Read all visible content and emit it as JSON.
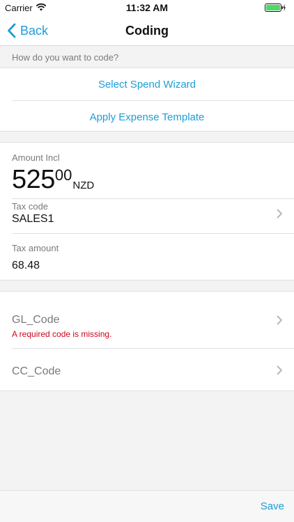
{
  "status_bar": {
    "carrier": "Carrier",
    "time": "11:32 AM",
    "icons": [
      "wifi-icon",
      "battery-icon",
      "charging-bolt-icon"
    ]
  },
  "nav": {
    "back_label": "Back",
    "title": "Coding"
  },
  "coding_section": {
    "header": "How do you want to code?",
    "options": [
      "Select Spend Wizard",
      "Apply Expense Template"
    ]
  },
  "amount": {
    "label": "Amount Incl",
    "whole": "525",
    "cents": "00",
    "currency": "NZD"
  },
  "tax_code": {
    "label": "Tax code",
    "value": "SALES1"
  },
  "tax_amount": {
    "label": "Tax amount",
    "value": "68.48"
  },
  "codes": {
    "gl_code": {
      "label": "GL_Code",
      "error": "A required code is missing."
    },
    "cc_code": {
      "label": "CC_Code"
    }
  },
  "footer": {
    "save_label": "Save"
  },
  "colors": {
    "accent": "#1b9ed8",
    "error": "#d0021b",
    "battery": "#4cd964"
  }
}
